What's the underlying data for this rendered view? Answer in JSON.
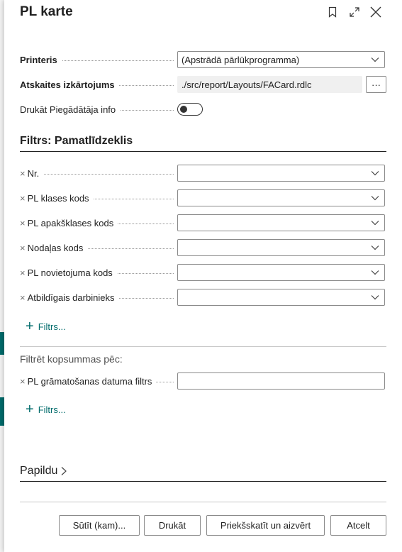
{
  "dialog": {
    "title": "PL karte"
  },
  "options": {
    "printer_label": "Printeris",
    "printer_value": "(Apstrādā pārlūkprogramma)",
    "layout_label": "Atskaites izkārtojums",
    "layout_value": "./src/report/Layouts/FACard.rdlc",
    "more_label": "···",
    "supplier_label": "Drukāt Piegādātāja info"
  },
  "filters": {
    "header": "Filtrs: Pamatlīdzeklis",
    "remove_glyph": "×",
    "items": [
      {
        "label": "Nr."
      },
      {
        "label": "PL klases kods"
      },
      {
        "label": "PL apakšklases kods"
      },
      {
        "label": "Nodaļas kods"
      },
      {
        "label": "PL novietojuma kods"
      },
      {
        "label": "Atbildīgais darbinieks"
      }
    ],
    "add_label": "Filtrs..."
  },
  "totals": {
    "header": "Filtrēt kopsummas pēc:",
    "items": [
      {
        "label": "PL grāmatošanas datuma filtrs"
      }
    ],
    "add_label": "Filtrs..."
  },
  "advanced": {
    "label": "Papildu"
  },
  "buttons": {
    "send": "Sūtīt (kam)...",
    "print": "Drukāt",
    "preview": "Priekšskatīt un aizvērt",
    "cancel": "Atcelt"
  }
}
